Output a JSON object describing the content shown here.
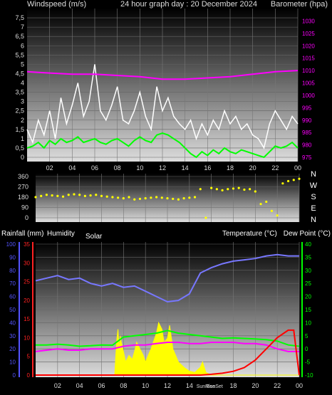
{
  "chart_data": [
    {
      "type": "line",
      "title": "24 hour graph day : 20 December 2024",
      "left_axis_label": "Windspeed (m/s)",
      "right_axis_label": "Barometer (hpa)",
      "x_ticks": [
        "02",
        "04",
        "06",
        "08",
        "10",
        "12",
        "14",
        "16",
        "18",
        "20",
        "22",
        "00"
      ],
      "xlim": [
        0,
        24
      ],
      "left_ylim": [
        0,
        8
      ],
      "left_ticks": [
        "0",
        "0,5",
        "1",
        "1,5",
        "2",
        "2,5",
        "3",
        "3,5",
        "4",
        "4,5",
        "5",
        "5,5",
        "6",
        "6,5",
        "7",
        "7,5"
      ],
      "right_ylim": [
        975,
        1035
      ],
      "right_ticks": [
        "975",
        "980",
        "985",
        "990",
        "995",
        "1000",
        "1005",
        "1010",
        "1015",
        "1020",
        "1025",
        "1030"
      ],
      "series": [
        {
          "color": "#ffffff",
          "axis": "left",
          "x": [
            0.0,
            0.5,
            1.0,
            1.5,
            2.0,
            2.5,
            3.0,
            3.5,
            4.0,
            4.5,
            5.0,
            5.5,
            6.0,
            6.5,
            7.0,
            7.5,
            8.0,
            8.5,
            9.0,
            9.5,
            10.0,
            10.5,
            11.0,
            11.5,
            12.0,
            12.5,
            13.0,
            13.5,
            14.0,
            14.5,
            15.0,
            15.5,
            16.0,
            16.5,
            17.0,
            17.5,
            18.0,
            18.5,
            19.0,
            19.5,
            20.0,
            20.5,
            21.0,
            21.5,
            22.0,
            22.5,
            23.0,
            23.5,
            24.0
          ],
          "y": [
            1.5,
            0.8,
            2.0,
            1.2,
            2.5,
            1.0,
            3.2,
            1.8,
            2.8,
            4.0,
            2.2,
            3.0,
            5.0,
            2.5,
            2.0,
            2.8,
            3.8,
            2.0,
            1.8,
            2.5,
            3.5,
            2.2,
            1.5,
            3.8,
            2.5,
            3.2,
            2.2,
            1.8,
            1.5,
            2.0,
            1.0,
            1.8,
            1.2,
            2.0,
            1.5,
            2.5,
            1.8,
            2.2,
            1.5,
            1.8,
            1.2,
            1.0,
            0.5,
            1.8,
            2.5,
            2.0,
            1.5,
            2.2,
            1.8
          ]
        },
        {
          "color": "#00ff00",
          "axis": "left",
          "x": [
            0.0,
            0.5,
            1.0,
            1.5,
            2.0,
            2.5,
            3.0,
            3.5,
            4.0,
            4.5,
            5.0,
            5.5,
            6.0,
            6.5,
            7.0,
            7.5,
            8.0,
            8.5,
            9.0,
            9.5,
            10.0,
            10.5,
            11.0,
            11.5,
            12.0,
            12.5,
            13.0,
            13.5,
            14.0,
            14.5,
            15.0,
            15.5,
            16.0,
            16.5,
            17.0,
            17.5,
            18.0,
            18.5,
            19.0,
            19.5,
            20.0,
            20.5,
            21.0,
            21.5,
            22.0,
            22.5,
            23.0,
            23.5,
            24.0
          ],
          "y": [
            0.5,
            0.6,
            0.8,
            0.5,
            0.9,
            0.7,
            1.0,
            0.8,
            0.9,
            1.1,
            0.8,
            0.9,
            1.0,
            0.8,
            0.7,
            0.9,
            1.0,
            0.8,
            0.6,
            0.9,
            1.1,
            0.9,
            0.8,
            1.2,
            1.3,
            1.2,
            1.0,
            0.8,
            0.5,
            0.2,
            0.0,
            0.3,
            0.1,
            0.4,
            0.2,
            0.5,
            0.3,
            0.2,
            0.4,
            0.3,
            0.2,
            0.1,
            0.0,
            0.3,
            0.6,
            0.5,
            0.6,
            0.8,
            0.5
          ]
        },
        {
          "color": "#ff00ff",
          "axis": "right",
          "x": [
            0,
            2,
            4,
            6,
            8,
            10,
            12,
            14,
            16,
            18,
            20,
            22,
            24
          ],
          "y": [
            1009.5,
            1009.0,
            1008.5,
            1008.5,
            1008.0,
            1007.5,
            1006.5,
            1006.5,
            1007.0,
            1007.5,
            1008.5,
            1009.5,
            1010.0
          ]
        }
      ]
    },
    {
      "type": "scatter",
      "xlim": [
        0,
        24
      ],
      "ylim": [
        0,
        360
      ],
      "y_ticks": [
        "0",
        "90",
        "180",
        "270",
        "360"
      ],
      "x_ticks": [
        "02",
        "04",
        "06",
        "08",
        "10",
        "12",
        "14",
        "16",
        "18",
        "20",
        "22",
        "00"
      ],
      "direction_labels": [
        "N",
        "W",
        "S",
        "E",
        "N"
      ],
      "series": [
        {
          "color": "#ffff00",
          "x": [
            0.0,
            0.5,
            1.0,
            1.5,
            2.0,
            2.5,
            3.0,
            3.5,
            4.0,
            4.5,
            5.0,
            5.5,
            6.0,
            6.5,
            7.0,
            7.5,
            8.0,
            8.5,
            9.0,
            9.5,
            10.0,
            10.5,
            11.0,
            11.5,
            12.0,
            12.5,
            13.0,
            13.5,
            14.0,
            14.5,
            15.0,
            15.5,
            16.0,
            16.5,
            17.0,
            17.5,
            18.0,
            18.5,
            19.0,
            19.5,
            20.0,
            20.5,
            21.0,
            21.5,
            22.0,
            22.5,
            23.0,
            23.5,
            24.0
          ],
          "y": [
            180,
            190,
            200,
            195,
            190,
            185,
            200,
            205,
            200,
            190,
            195,
            200,
            190,
            185,
            180,
            175,
            170,
            180,
            160,
            165,
            170,
            175,
            180,
            175,
            170,
            165,
            160,
            170,
            175,
            180,
            250,
            0,
            260,
            250,
            240,
            250,
            255,
            260,
            245,
            250,
            230,
            120,
            140,
            60,
            20,
            300,
            320,
            330,
            340
          ]
        }
      ]
    },
    {
      "type": "line",
      "axis_labels": [
        "Rainfall (mm)",
        "Humidity",
        "Solar",
        "Temperature (°C)",
        "Dew Point (°C)"
      ],
      "x_ticks": [
        "02",
        "04",
        "06",
        "08",
        "10",
        "12",
        "14",
        "SunRise",
        "SunSet",
        "18",
        "20",
        "22",
        "00"
      ],
      "sun_labels": [
        "SunRise",
        "SunSet"
      ],
      "xlim": [
        0,
        24
      ],
      "humidity_axis": {
        "color": "#5555ff",
        "range": [
          0,
          100
        ],
        "ticks": [
          "0",
          "10",
          "20",
          "30",
          "40",
          "50",
          "60",
          "70",
          "80",
          "90",
          "100"
        ]
      },
      "rain_axis": {
        "color": "#ff2222",
        "range": [
          0,
          35
        ],
        "ticks": [
          "0",
          "5",
          "10",
          "15",
          "20",
          "25",
          "30",
          "35"
        ]
      },
      "temp_axis": {
        "color": "#00ff00",
        "range": [
          -10,
          40
        ],
        "ticks": [
          "-10",
          "-5",
          "0",
          "5",
          "10",
          "15",
          "20",
          "25",
          "30",
          "35",
          "40"
        ]
      },
      "series": [
        {
          "color": "#7777ff",
          "axis": "humidity",
          "x": [
            0,
            1,
            2,
            3,
            4,
            5,
            6,
            7,
            8,
            9,
            10,
            11,
            12,
            13,
            14,
            15,
            16,
            17,
            18,
            19,
            20,
            21,
            22,
            23,
            24
          ],
          "y": [
            72,
            74,
            76,
            73,
            74,
            70,
            68,
            70,
            67,
            68,
            64,
            60,
            56,
            57,
            62,
            78,
            82,
            85,
            87,
            88,
            89,
            91,
            92,
            91,
            91
          ]
        },
        {
          "color": "#00ff00",
          "axis": "temp",
          "x": [
            0,
            1,
            2,
            3,
            4,
            5,
            6,
            7,
            8,
            9,
            10,
            11,
            12,
            13,
            14,
            15,
            16,
            17,
            18,
            19,
            20,
            21,
            22,
            23,
            24
          ],
          "y": [
            1.5,
            1.5,
            1.8,
            1.5,
            1.0,
            1.2,
            1.5,
            1.4,
            4.5,
            5.0,
            5.5,
            6.0,
            7.0,
            6.0,
            5.5,
            5.0,
            4.5,
            4.0,
            4.2,
            4.0,
            3.8,
            3.5,
            3.0,
            1.5,
            1.0
          ]
        },
        {
          "color": "#ff00ff",
          "axis": "temp",
          "x": [
            0,
            1,
            2,
            3,
            4,
            5,
            6,
            7,
            8,
            9,
            10,
            11,
            12,
            13,
            14,
            15,
            16,
            17,
            18,
            19,
            20,
            21,
            22,
            23,
            24
          ],
          "y": [
            -1.0,
            -0.5,
            0.0,
            -0.5,
            -0.5,
            0.0,
            0.0,
            0.0,
            1.0,
            1.5,
            1.5,
            2.0,
            2.5,
            2.5,
            2.0,
            2.0,
            2.5,
            2.5,
            2.5,
            2.0,
            2.0,
            1.5,
            0.0,
            -1.0,
            -1.0
          ]
        },
        {
          "color": "#ff0000",
          "axis": "rain",
          "x": [
            0,
            14,
            15,
            16,
            17,
            18,
            19,
            20,
            21,
            22,
            23,
            23.5,
            24
          ],
          "y": [
            0,
            0,
            0,
            0.2,
            0.5,
            1.0,
            2.0,
            4.0,
            7.0,
            10.0,
            12.0,
            12.0,
            0
          ]
        },
        {
          "color": "#ffff00",
          "axis": "humidity",
          "fill": true,
          "x": [
            0,
            7.2,
            7.3,
            7.4,
            7.5,
            7.6,
            7.7,
            7.8,
            8.0,
            8.2,
            8.5,
            8.8,
            9.0,
            9.2,
            9.5,
            9.8,
            10.0,
            10.5,
            11.0,
            11.2,
            11.5,
            11.7,
            12.0,
            12.2,
            12.5,
            13.0,
            13.5,
            14.0,
            14.5,
            15.0,
            15.2,
            15.5,
            16.0,
            24
          ],
          "y": [
            0,
            0,
            15,
            28,
            35,
            20,
            30,
            25,
            18,
            10,
            15,
            12,
            18,
            25,
            20,
            15,
            10,
            20,
            32,
            40,
            35,
            25,
            28,
            38,
            20,
            10,
            6,
            3,
            2,
            6,
            10,
            2,
            0,
            0
          ]
        }
      ]
    }
  ]
}
